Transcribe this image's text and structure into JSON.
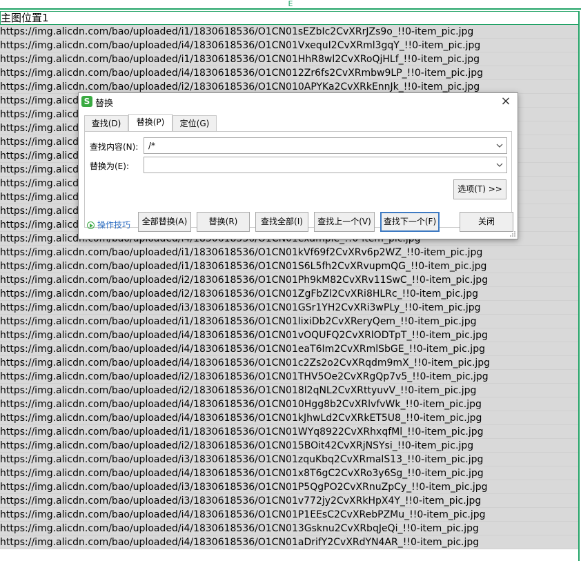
{
  "sheet": {
    "column_letter": "E",
    "header_cell": "主图位置1",
    "rows": [
      "https://img.alicdn.com/bao/uploaded/i1/1830618536/O1CN01sEZbIc2CvXRrJZs9o_!!0-item_pic.jpg",
      "https://img.alicdn.com/bao/uploaded/i4/1830618536/O1CN01VxequI2CvXRml3gqY_!!0-item_pic.jpg",
      "https://img.alicdn.com/bao/uploaded/i1/1830618536/O1CN01HhR8wl2CvXRoQjHLf_!!0-item_pic.jpg",
      "https://img.alicdn.com/bao/uploaded/i4/1830618536/O1CN012Zr6fs2CvXRmbw9LP_!!0-item_pic.jpg",
      "https://img.alicdn.com/bao/uploaded/i2/1830618536/O1CN010APYKa2CvXRkEnnJk_!!0-item_pic.jpg",
      "https://img.alicdn.com/bao/uploaded/i3/1830618536/O1CN01example_!!0-item_pic.jpg",
      "https://img.alicdn.com/bao/uploaded/i4/1830618536/O1CN01example_!!0-item_pic.jpg",
      "https://img.alicdn.com/bao/uploaded/i1/1830618536/O1CN01example_!!0-item_pic.jpg",
      "https://img.alicdn.com/bao/uploaded/i2/1830618536/O1CN01example_!!0-item_pic.jpg",
      "https://img.alicdn.com/bao/uploaded/i3/1830618536/O1CN01example_!!0-item_pic.jpg",
      "https://img.alicdn.com/bao/uploaded/i4/1830618536/O1CN01example_!!0-item_pic.jpg",
      "https://img.alicdn.com/bao/uploaded/i1/1830618536/O1CN01example_!!0-item_pic.jpg",
      "https://img.alicdn.com/bao/uploaded/i2/1830618536/O1CN01example_!!0-item_pic.jpg",
      "https://img.alicdn.com/bao/uploaded/i3/1830618536/O1CN01example_!!0-item_pic.jpg",
      "https://img.alicdn.com/bao/uploaded/i4/1830618536/O1CN01example_!!0-item_pic.jpg",
      "https://img.alicdn.com/bao/uploaded/i4/1830618536/O1CN01example_!!0-item_pic.jpg",
      "https://img.alicdn.com/bao/uploaded/i1/1830618536/O1CN01kVf69f2CvXRv6p2WZ_!!0-item_pic.jpg",
      "https://img.alicdn.com/bao/uploaded/i1/1830618536/O1CN01S6L5fh2CvXRvupmQG_!!0-item_pic.jpg",
      "https://img.alicdn.com/bao/uploaded/i2/1830618536/O1CN01Ph9kM82CvXRv11SwC_!!0-item_pic.jpg",
      "https://img.alicdn.com/bao/uploaded/i2/1830618536/O1CN01ZgFbZl2CvXRi8HLRc_!!0-item_pic.jpg",
      "https://img.alicdn.com/bao/uploaded/i3/1830618536/O1CN01GSr1YH2CvXRi3wPLy_!!0-item_pic.jpg",
      "https://img.alicdn.com/bao/uploaded/i1/1830618536/O1CN01lixiDb2CvXReryQem_!!0-item_pic.jpg",
      "https://img.alicdn.com/bao/uploaded/i4/1830618536/O1CN01vOQUFQ2CvXRlODTpT_!!0-item_pic.jpg",
      "https://img.alicdn.com/bao/uploaded/i4/1830618536/O1CN01eaT6Im2CvXRmlSbGE_!!0-item_pic.jpg",
      "https://img.alicdn.com/bao/uploaded/i4/1830618536/O1CN01c2Zs2o2CvXRqdm9mX_!!0-item_pic.jpg",
      "https://img.alicdn.com/bao/uploaded/i2/1830618536/O1CN01THV5Oe2CvXRgQp7v5_!!0-item_pic.jpg",
      "https://img.alicdn.com/bao/uploaded/i2/1830618536/O1CN018l2qNL2CvXRttyuvV_!!0-item_pic.jpg",
      "https://img.alicdn.com/bao/uploaded/i4/1830618536/O1CN010Hgg8b2CvXRlvfvWk_!!0-item_pic.jpg",
      "https://img.alicdn.com/bao/uploaded/i4/1830618536/O1CN01kJhwLd2CvXRkET5U8_!!0-item_pic.jpg",
      "https://img.alicdn.com/bao/uploaded/i1/1830618536/O1CN01WYq8922CvXRhxqfMl_!!0-item_pic.jpg",
      "https://img.alicdn.com/bao/uploaded/i2/1830618536/O1CN015BOit42CvXRjNSYsi_!!0-item_pic.jpg",
      "https://img.alicdn.com/bao/uploaded/i3/1830618536/O1CN01zquKbq2CvXRmalS13_!!0-item_pic.jpg",
      "https://img.alicdn.com/bao/uploaded/i4/1830618536/O1CN01x8T6gC2CvXRo3y6Sg_!!0-item_pic.jpg",
      "https://img.alicdn.com/bao/uploaded/i3/1830618536/O1CN01P5QgPO2CvXRnuZpCy_!!0-item_pic.jpg",
      "https://img.alicdn.com/bao/uploaded/i3/1830618536/O1CN01v772jy2CvXRkHpX4Y_!!0-item_pic.jpg",
      "https://img.alicdn.com/bao/uploaded/i4/1830618536/O1CN01P1EEsC2CvXRebPZMu_!!0-item_pic.jpg",
      "https://img.alicdn.com/bao/uploaded/i4/1830618536/O1CN013Gsknu2CvXRbqJeQi_!!0-item_pic.jpg",
      "https://img.alicdn.com/bao/uploaded/i4/1830618536/O1CN01aDrifY2CvXRdYN4AR_!!0-item_pic.jpg"
    ]
  },
  "dialog": {
    "title": "替换",
    "app_icon_letter": "S",
    "tabs": [
      "查找(D)",
      "替换(P)",
      "定位(G)"
    ],
    "active_tab": 1,
    "find_label": "查找内容(N):",
    "find_value": "/*",
    "replace_label": "替换为(E):",
    "replace_value": "",
    "options_button": "选项(T) >>",
    "help_link": "操作技巧",
    "buttons": {
      "replace_all": "全部替换(A)",
      "replace": "替换(R)",
      "find_all": "查找全部(I)",
      "find_prev": "查找上一个(V)",
      "find_next": "查找下一个(F)",
      "close": "关闭"
    }
  },
  "colors": {
    "accent_green": "#21a366",
    "selection_gray": "#d9d9d9",
    "focus_blue": "#3e7ac2",
    "link_blue": "#2f6fc2"
  }
}
